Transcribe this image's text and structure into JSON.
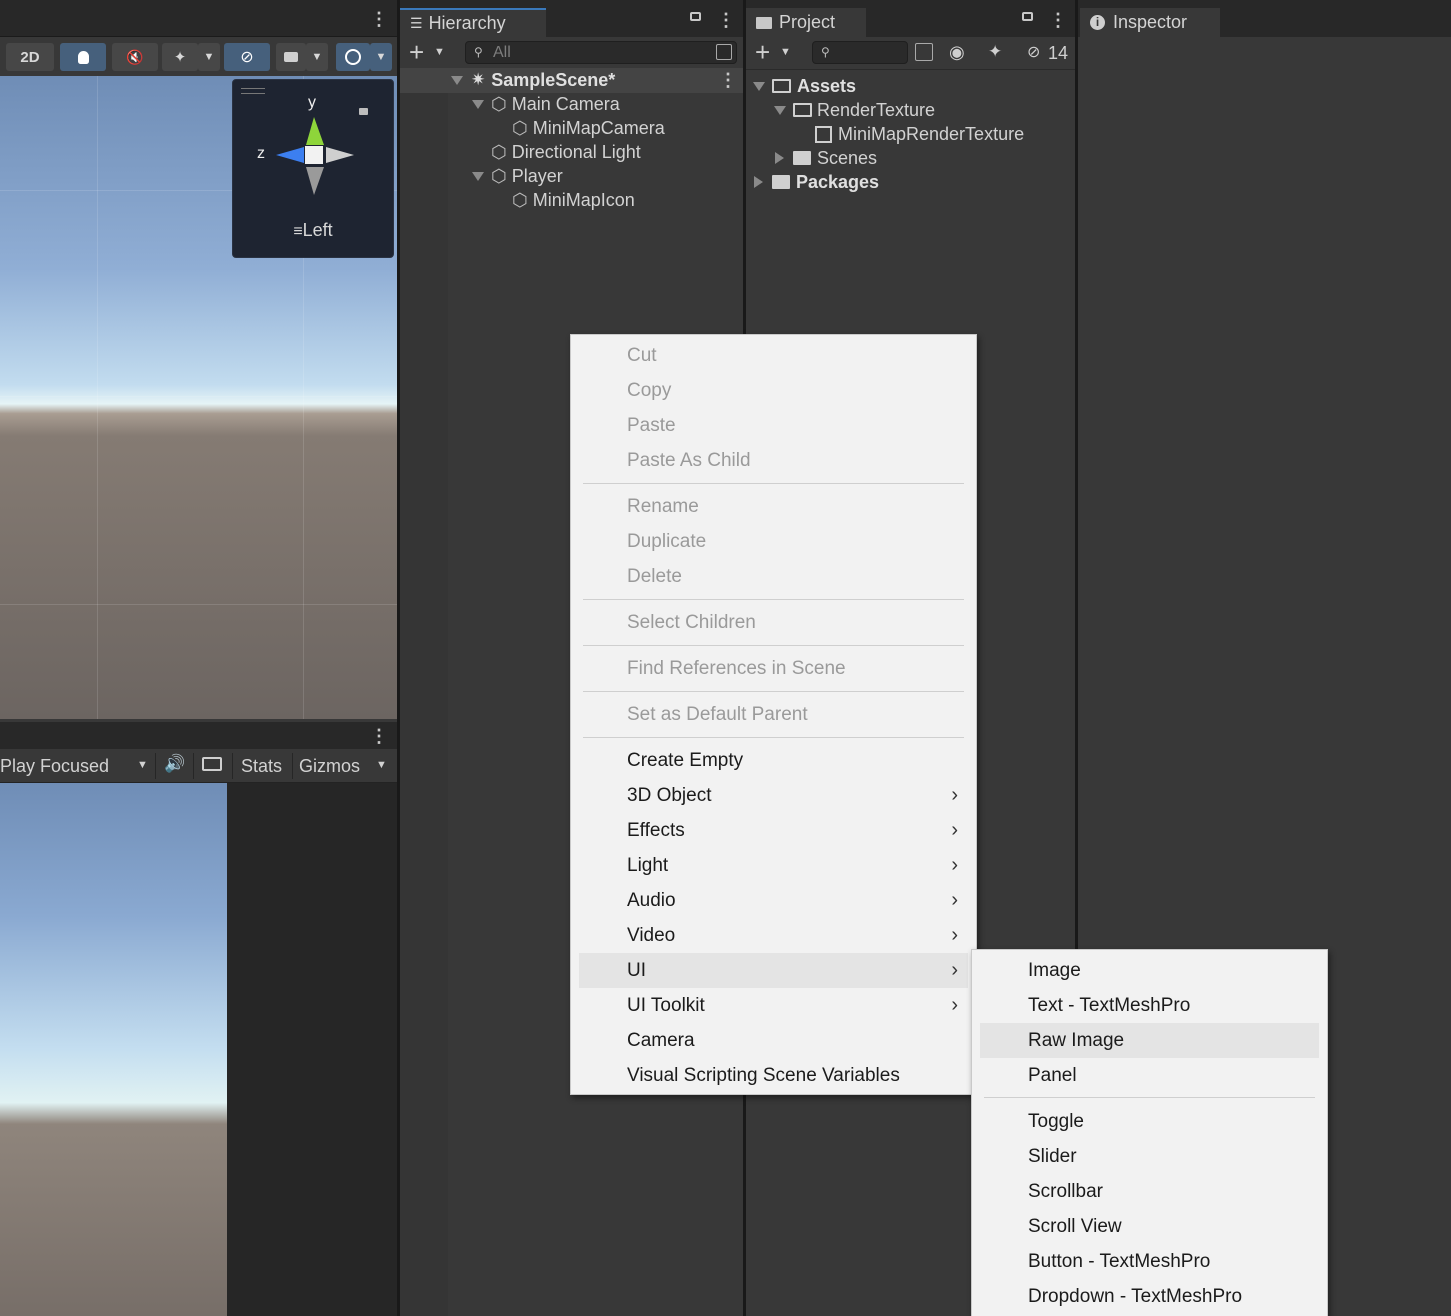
{
  "scene": {
    "toolbar": {
      "mode_2d": "2D"
    },
    "gizmo": {
      "y": "y",
      "z": "z",
      "view": "Left"
    }
  },
  "game": {
    "play_mode": "Play Focused",
    "stats": "Stats",
    "gizmos": "Gizmos"
  },
  "hierarchy": {
    "tab": "Hierarchy",
    "search_placeholder": "All",
    "scene_name": "SampleScene*",
    "items": [
      "Main Camera",
      "MiniMapCamera",
      "Directional Light",
      "Player",
      "MiniMapIcon"
    ]
  },
  "project": {
    "tab": "Project",
    "hidden_count": "14",
    "tree": [
      "Assets",
      "RenderTexture",
      "MiniMapRenderTexture",
      "Scenes",
      "Packages"
    ]
  },
  "inspector": {
    "tab": "Inspector"
  },
  "context_menu": {
    "items": [
      "Cut",
      "Copy",
      "Paste",
      "Paste As Child",
      "Rename",
      "Duplicate",
      "Delete",
      "Select Children",
      "Find References in Scene",
      "Set as Default Parent",
      "Create Empty",
      "3D Object",
      "Effects",
      "Light",
      "Audio",
      "Video",
      "UI",
      "UI Toolkit",
      "Camera",
      "Visual Scripting Scene Variables"
    ]
  },
  "ui_submenu": {
    "items": [
      "Image",
      "Text - TextMeshPro",
      "Raw Image",
      "Panel",
      "Toggle",
      "Slider",
      "Scrollbar",
      "Scroll View",
      "Button - TextMeshPro",
      "Dropdown - TextMeshPro"
    ]
  }
}
